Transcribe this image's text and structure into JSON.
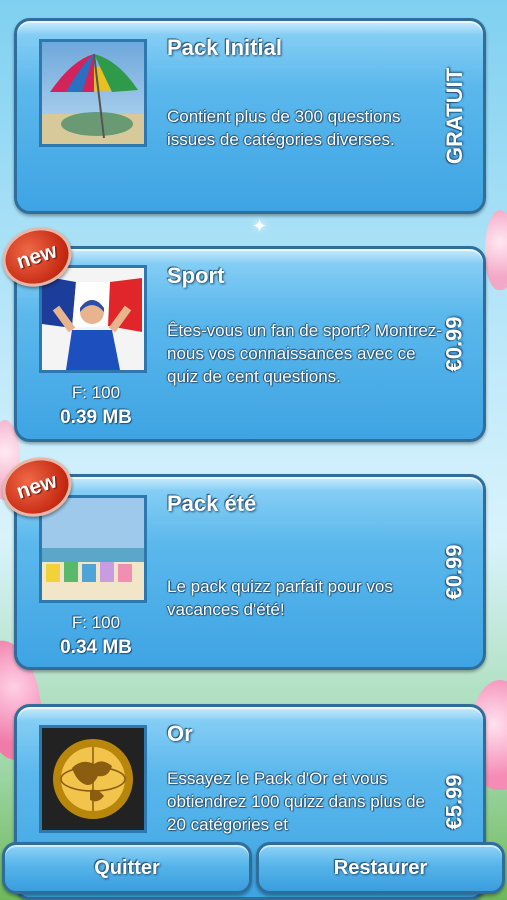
{
  "packs": [
    {
      "title": "Pack Initial",
      "description": "Contient plus de 300 questions issues de catégories diverses.",
      "price": "GRATUIT",
      "thumbnail": "umbrella-image"
    },
    {
      "title": "Sport",
      "description": "Êtes-vous un fan de sport? Montrez-nous vos connaissances avec ce quiz de cent questions.",
      "price": "€0.99",
      "badge": "new",
      "freq": "F: 100",
      "size": "0.39 MB",
      "thumbnail": "sport-fan-flag-image"
    },
    {
      "title": "Pack été",
      "description": "Le pack quizz parfait pour vos vacances d'été!",
      "price": "€0.99",
      "badge": "new",
      "freq": "F: 100",
      "size": "0.34 MB",
      "thumbnail": "beach-chairs-image"
    },
    {
      "title": "Or",
      "description": "Essayez le Pack d'Or et vous obtiendrez 100 quizz dans plus de 20 catégories et",
      "price": "€5.99",
      "thumbnail": "gold-globe-emblem-image"
    }
  ],
  "buttons": {
    "quit": "Quitter",
    "restore": "Restaurer"
  },
  "colors": {
    "card_top": "#8fd3f7",
    "card_bottom": "#3ea4e3",
    "card_border": "#2f6e9a",
    "badge_red": "#c62a12"
  }
}
